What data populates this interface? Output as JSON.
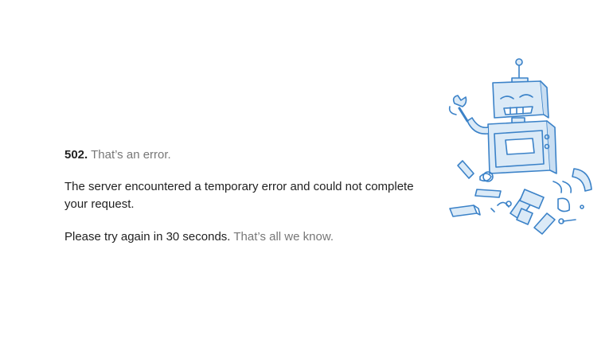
{
  "error": {
    "code": "502.",
    "headline": "That’s an error.",
    "message": "The server encountered a temporary error and could not complete your request.",
    "retry": "Please try again in 30 seconds.",
    "footer": "That’s all we know."
  },
  "illustration": {
    "icon": "broken-robot-icon",
    "stroke_color": "#3b82c8",
    "fill_color": "#dbeaf7"
  }
}
